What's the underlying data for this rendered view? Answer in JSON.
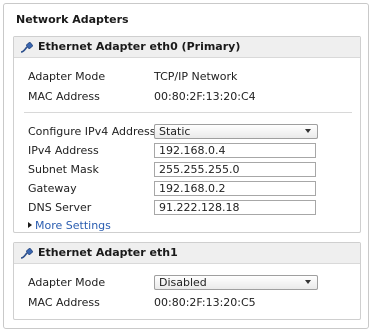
{
  "panel": {
    "title": "Network Adapters"
  },
  "eth0": {
    "title": "Ethernet Adapter eth0 (Primary)",
    "icon": "ethernet-cable-icon",
    "adapter_mode_label": "Adapter Mode",
    "adapter_mode_value": "TCP/IP Network",
    "mac_label": "MAC Address",
    "mac_value": "00:80:2F:13:20:C4",
    "ipv4_config_label": "Configure IPv4 Address",
    "ipv4_config_value": "Static",
    "ipv4_label": "IPv4 Address",
    "ipv4_value": "192.168.0.4",
    "subnet_label": "Subnet Mask",
    "subnet_value": "255.255.255.0",
    "gateway_label": "Gateway",
    "gateway_value": "192.168.0.2",
    "dns_label": "DNS Server",
    "dns_value": "91.222.128.18",
    "more_settings": "More Settings"
  },
  "eth1": {
    "title": "Ethernet Adapter eth1",
    "icon": "ethernet-cable-icon",
    "adapter_mode_label": "Adapter Mode",
    "adapter_mode_value": "Disabled",
    "mac_label": "MAC Address",
    "mac_value": "00:80:2F:13:20:C5"
  },
  "colors": {
    "link": "#2a5db0",
    "header_bg": "#efefef",
    "border": "#cfcfcf"
  }
}
